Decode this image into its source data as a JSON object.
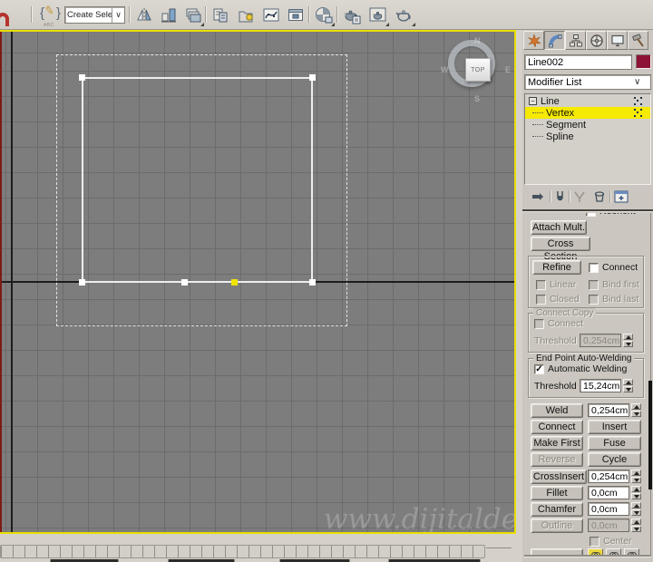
{
  "toolbar": {
    "selection_set_value": "Create Selection Se",
    "named_sets_sub": "ABC",
    "icons": [
      "snap-magnet-icon",
      "edit-named-selection-sets-icon",
      "mirror-icon",
      "align-icon",
      "layer-manager-icon",
      "manage-scene-icon",
      "container-icon",
      "curve-editor-icon",
      "schematic-view-icon",
      "material-editor-icon",
      "render-setup-icon",
      "rendered-frame-window-icon",
      "render-production-icon"
    ]
  },
  "viewport": {
    "viewcube": {
      "face_label": "TOP",
      "north": "N",
      "south": "S",
      "east": "E",
      "west": "W"
    },
    "watermark": "www.dijitalde",
    "selected_vertex_color": "#f0e400",
    "vertex_color": "#ffffff",
    "active_border_color": "#e9de00",
    "background_color": "#7d7d7d"
  },
  "panel": {
    "tabs": [
      "create",
      "modify",
      "hierarchy",
      "motion",
      "display",
      "utilities"
    ],
    "active_tab": "modify",
    "object_name": "Line002",
    "object_color": "#8d1336",
    "modifier_list_label": "Modifier List",
    "stack": {
      "items": [
        {
          "label": "Line"
        },
        {
          "label": "Vertex",
          "selected": true
        },
        {
          "label": "Segment"
        },
        {
          "label": "Spline"
        }
      ]
    },
    "stack_icons": [
      "pin-stack-icon",
      "show-end-result-icon",
      "make-unique-icon",
      "remove-modifier-icon",
      "configure-modifier-sets-icon"
    ],
    "geometry": {
      "reorient": "Reorient",
      "attach_mult": "Attach Mult.",
      "cross_section": "Cross Section",
      "refine": "Refine",
      "connect_check": "Connect",
      "linear": "Linear",
      "closed": "Closed",
      "bind_first": "Bind first",
      "bind_last": "Bind last",
      "connect_copy_title": "Connect Copy",
      "connect_copy_check": "Connect",
      "threshold_label": "Threshold",
      "connect_copy_threshold": "0,254cm",
      "autoweld_title": "End Point Auto-Welding",
      "autoweld_check": "Automatic Welding",
      "autoweld_checked": true,
      "autoweld_threshold": "15,24cm",
      "weld": "Weld",
      "weld_value": "0,254cm",
      "connect": "Connect",
      "insert": "Insert",
      "make_first": "Make First",
      "fuse": "Fuse",
      "reverse": "Reverse",
      "cycle": "Cycle",
      "cross_insert": "CrossInsert",
      "cross_insert_value": "0,254cm",
      "fillet": "Fillet",
      "fillet_value": "0,0cm",
      "chamfer": "Chamfer",
      "chamfer_value": "0,0cm",
      "outline": "Outline",
      "outline_value": "0,0cm",
      "center": "Center"
    }
  }
}
